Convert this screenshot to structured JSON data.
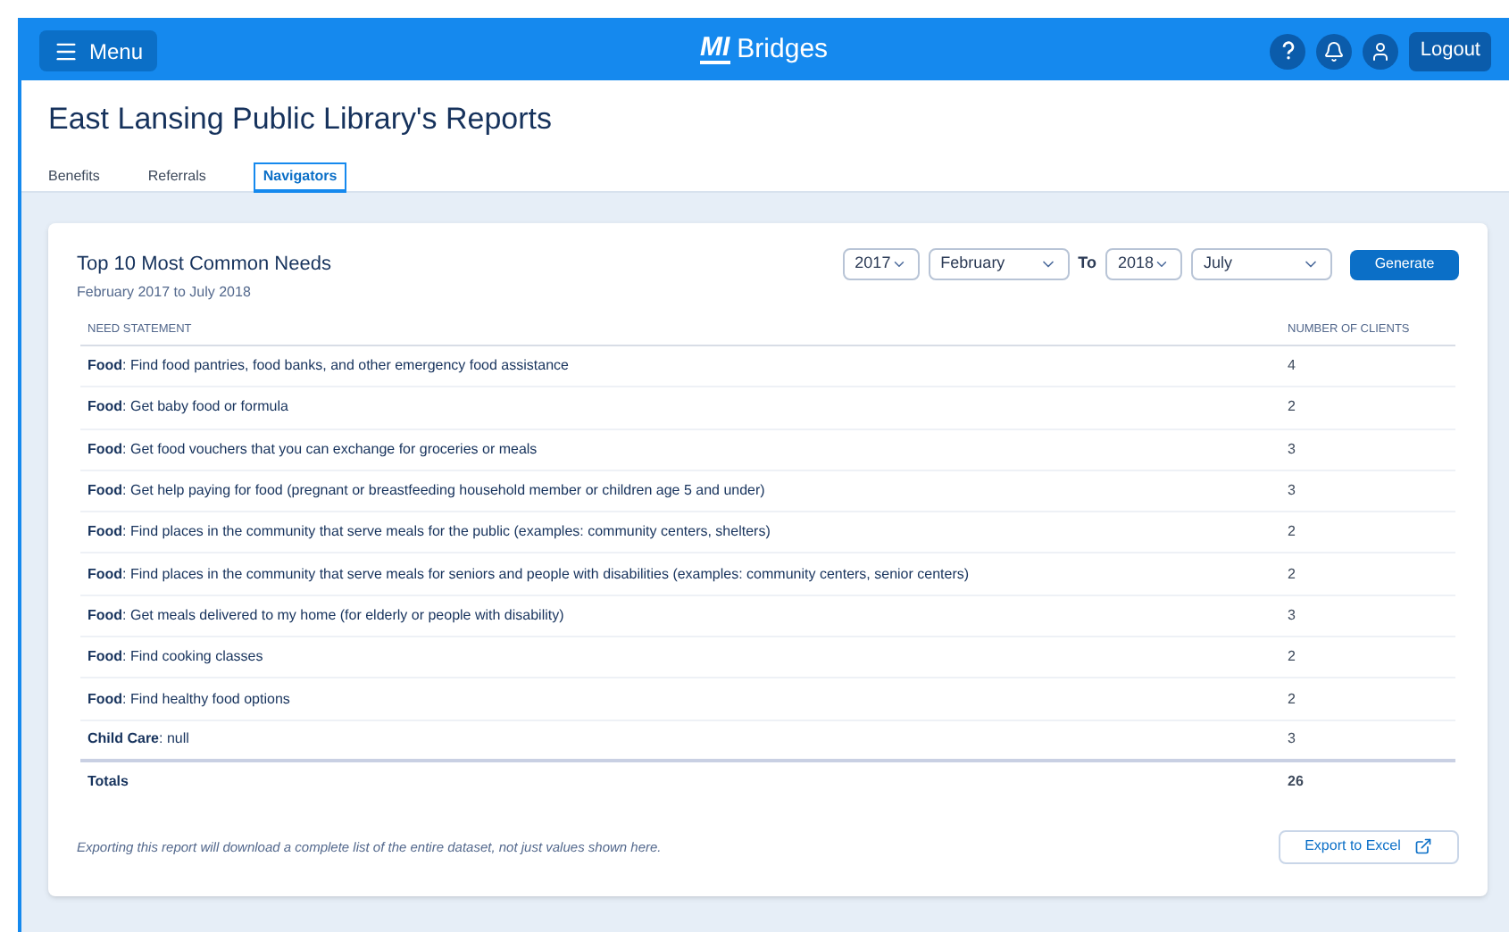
{
  "header": {
    "menu_label": "Menu",
    "logo_mark": "MI",
    "logo_text": "Bridges",
    "logout_label": "Logout"
  },
  "page_title": "East Lansing Public Library's Reports",
  "tabs": [
    {
      "label": "Benefits",
      "selected": false
    },
    {
      "label": "Referrals",
      "selected": false
    },
    {
      "label": "Navigators",
      "selected": true
    }
  ],
  "report": {
    "title": "Top 10 Most Common Needs",
    "date_range": "February 2017 to July 2018",
    "filters": {
      "from_year": "2017",
      "from_month": "February",
      "to_label": "To",
      "to_year": "2018",
      "to_month": "July",
      "generate_label": "Generate"
    },
    "columns": [
      "NEED STATEMENT",
      "NUMBER OF CLIENTS"
    ],
    "rows": [
      {
        "statement": "**Food**: Find food pantries, food banks, and other emergency food assistance",
        "clients": "4"
      },
      {
        "statement": "**Food**: Get baby food or formula",
        "clients": "2"
      },
      {
        "statement": "**Food**: Get food vouchers that you can exchange for groceries or meals",
        "clients": "3"
      },
      {
        "statement": "**Food**: Get help paying for food (pregnant or breastfeeding household member or children age 5 and under)",
        "clients": "3"
      },
      {
        "statement": "**Food**: Find places in the community that serve meals for the public (examples: community centers, shelters)",
        "clients": "2"
      },
      {
        "statement": "**Food**: Find places in the community that serve meals for seniors and people with disabilities (examples: community centers, senior centers)",
        "clients": "2"
      },
      {
        "statement": "**Food**: Get meals delivered to my home (for elderly or people with disability)",
        "clients": "3"
      },
      {
        "statement": "**Food**: Find cooking classes",
        "clients": "2"
      },
      {
        "statement": "**Food**: Find healthy food options",
        "clients": "2"
      },
      {
        "statement": "**Child Care**: null",
        "clients": "3"
      }
    ],
    "totals": {
      "label": "Totals",
      "value": "26"
    },
    "export_note": "Exporting this report will download a complete list of the entire dataset, not just values shown here.",
    "export_label": "Export to Excel"
  }
}
